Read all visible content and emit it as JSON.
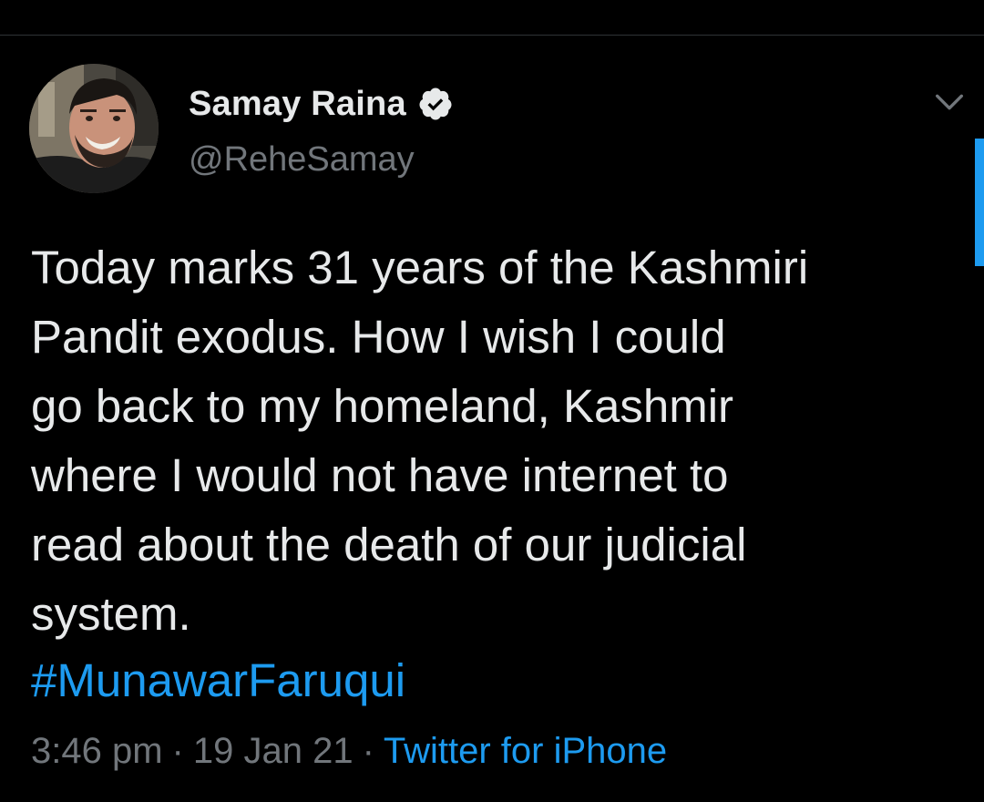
{
  "user": {
    "display_name": "Samay Raina",
    "handle": "@ReheSamay",
    "verified_icon": "verified-badge-icon",
    "avatar": "profile-photo"
  },
  "tweet": {
    "text": "Today marks 31 years of the Kashmiri\nPandit exodus. How I wish I could\ngo back to my homeland, Kashmir\nwhere I would not have internet to\nread about the death of our judicial\nsystem.",
    "hashtag": "#MunawarFaruqui",
    "time": "3:46 pm",
    "date": "19 Jan 21",
    "source": "Twitter for iPhone",
    "separator": "·"
  },
  "colors": {
    "background": "#000000",
    "text": "#e7e9ea",
    "secondary": "#71767b",
    "link": "#1d9bf0"
  },
  "icons": {
    "more": "chevron-down-icon"
  }
}
